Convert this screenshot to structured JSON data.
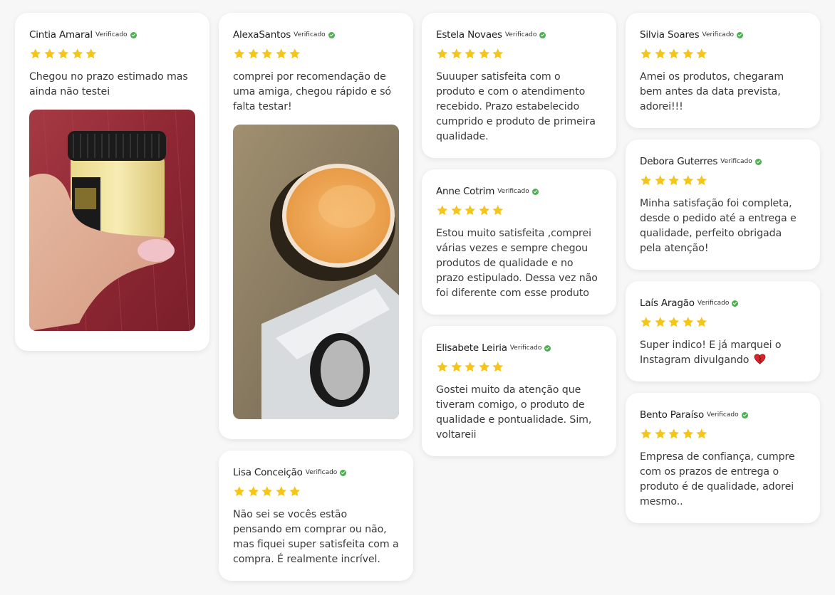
{
  "colors": {
    "star": "#f5c518",
    "verified": "#4caf50",
    "background": "#f7f7f7",
    "card": "#ffffff"
  },
  "reviews": [
    {
      "name": "Cintia Amaral",
      "verified": "Verificado",
      "rating": 5,
      "text": "Chegou no prazo estimado mas ainda não testei"
    },
    {
      "name": "AlexaSantos",
      "verified": "Verificado",
      "rating": 5,
      "text": "comprei por recomendação de uma amiga, chegou rápido e só falta testar!"
    },
    {
      "name": "Lisa Conceição",
      "verified": "Verificado",
      "rating": 5,
      "text": "Não sei se vocês estão pensando em comprar ou não, mas fiquei super satisfeita com a compra. É realmente incrível."
    },
    {
      "name": "Estela Novaes",
      "verified": "Verificado",
      "rating": 5,
      "text": "Suuuper satisfeita com o produto e com o atendimento recebido. Prazo estabelecido cumprido e produto de primeira qualidade."
    },
    {
      "name": "Anne Cotrim",
      "verified": "Verificado",
      "rating": 5,
      "text": "Estou muito satisfeita ,comprei várias vezes e sempre chegou produtos de qualidade e no prazo estipulado. Dessa vez não foi diferente com esse produto"
    },
    {
      "name": "Elisabete Leiria",
      "verified": "Verificado",
      "rating": 5,
      "text": "Gostei muito da atenção que tiveram comigo, o produto de qualidade e pontualidade. Sim, voltareii"
    },
    {
      "name": "Silvia Soares",
      "verified": "Verificado",
      "rating": 5,
      "text": "Amei os produtos, chegaram bem antes da data prevista, adorei!!!"
    },
    {
      "name": "Debora Guterres",
      "verified": "Verificado",
      "rating": 5,
      "text": "Minha satisfação foi completa, desde o pedido até a entrega e qualidade, perfeito obrigada pela atenção!"
    },
    {
      "name": "Laís Aragão",
      "verified": "Verificado",
      "rating": 5,
      "text": "Super indico! E já marquei o Instagram divulgando",
      "emoji_icon": "heart-icon"
    },
    {
      "name": "Bento Paraíso",
      "verified": "Verificado",
      "rating": 5,
      "text": "Empresa de confiança, cumpre com os prazos de entrega o produto é de qualidade, adorei mesmo.."
    }
  ]
}
